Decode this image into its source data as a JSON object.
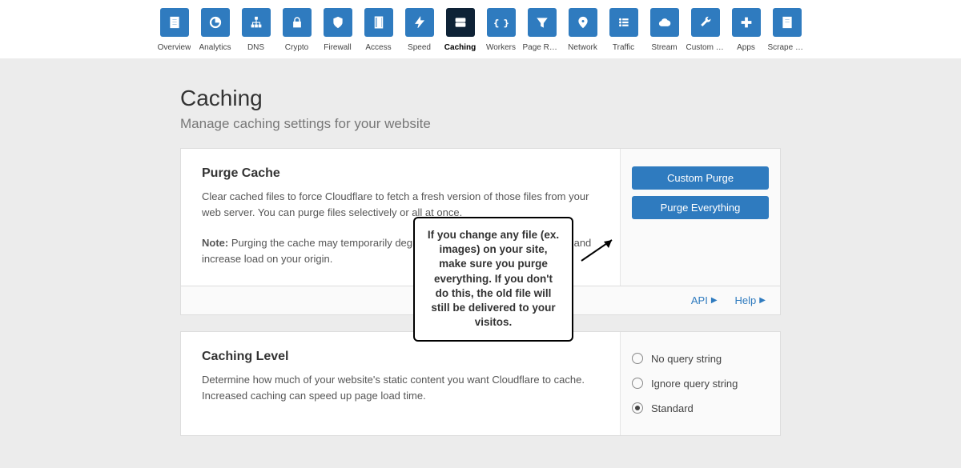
{
  "nav": {
    "items": [
      {
        "label": "Overview",
        "icon": "doc"
      },
      {
        "label": "Analytics",
        "icon": "pie"
      },
      {
        "label": "DNS",
        "icon": "tree"
      },
      {
        "label": "Crypto",
        "icon": "lock"
      },
      {
        "label": "Firewall",
        "icon": "shield"
      },
      {
        "label": "Access",
        "icon": "door"
      },
      {
        "label": "Speed",
        "icon": "bolt"
      },
      {
        "label": "Caching",
        "icon": "drive",
        "active": true
      },
      {
        "label": "Workers",
        "icon": "braces"
      },
      {
        "label": "Page Rules",
        "icon": "funnel"
      },
      {
        "label": "Network",
        "icon": "pin"
      },
      {
        "label": "Traffic",
        "icon": "list"
      },
      {
        "label": "Stream",
        "icon": "cloud"
      },
      {
        "label": "Custom P...",
        "icon": "wrench"
      },
      {
        "label": "Apps",
        "icon": "plus"
      },
      {
        "label": "Scrape Shi...",
        "icon": "page"
      }
    ]
  },
  "page": {
    "title": "Caching",
    "subtitle": "Manage caching settings for your website"
  },
  "purge": {
    "title": "Purge Cache",
    "text": "Clear cached files to force Cloudflare to fetch a fresh version of those files from your web server. You can purge files selectively or all at once.",
    "note_label": "Note:",
    "note_text": " Purging the cache may temporarily degrade performance for your website and increase load on your origin.",
    "custom_btn": "Custom Purge",
    "everything_btn": "Purge Everything"
  },
  "footer": {
    "api": "API",
    "help": "Help"
  },
  "level": {
    "title": "Caching Level",
    "text": "Determine how much of your website's static content you want Cloudflare to cache. Increased caching can speed up page load time.",
    "options": [
      {
        "label": "No query string",
        "selected": false
      },
      {
        "label": "Ignore query string",
        "selected": false
      },
      {
        "label": "Standard",
        "selected": true
      }
    ]
  },
  "callout": {
    "text": "If you change any file (ex. images) on your site, make sure you purge everything. If you don't do this, the old file will still be delivered to your visitos."
  }
}
